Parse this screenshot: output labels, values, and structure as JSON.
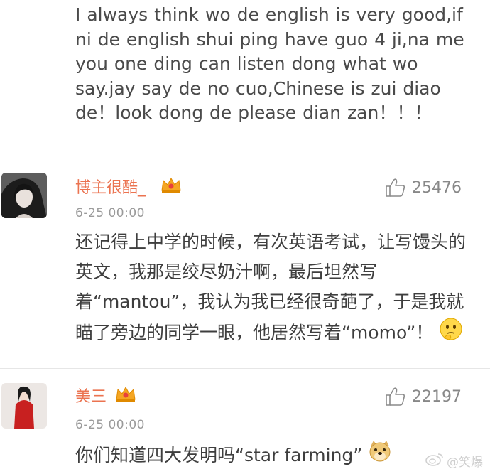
{
  "post": {
    "text": "I always think wo de english is very good,if ni de english shui ping have guo 4 ji,na me you one ding can listen dong what wo say.jay say de no cuo,Chinese is zui diao de！look dong de please dian zan！！！"
  },
  "comments": [
    {
      "username": "博主很酷_",
      "likes": "25476",
      "timestamp": "6-25 00:00",
      "text_before": "还记得上中学的时候，有次英语考试，让写馒头的英文，我那是绞尽奶汁啊，最后坦然写着“mantou”，我认为我已经很奇葩了，于是我就瞄了旁边的同学一眼，他居然写着“momo”！",
      "emoji": "thinking-face-emoji"
    },
    {
      "username": "美三",
      "likes": "22197",
      "timestamp": "6-25 00:00",
      "text_before": "你们知道四大发明吗“star farming”",
      "emoji": "doge-emoji"
    }
  ],
  "watermark": {
    "text": "@笑爆"
  },
  "colors": {
    "username": "#eb7350",
    "timestamp": "#9a9a9a",
    "crown": "#f5a623"
  }
}
